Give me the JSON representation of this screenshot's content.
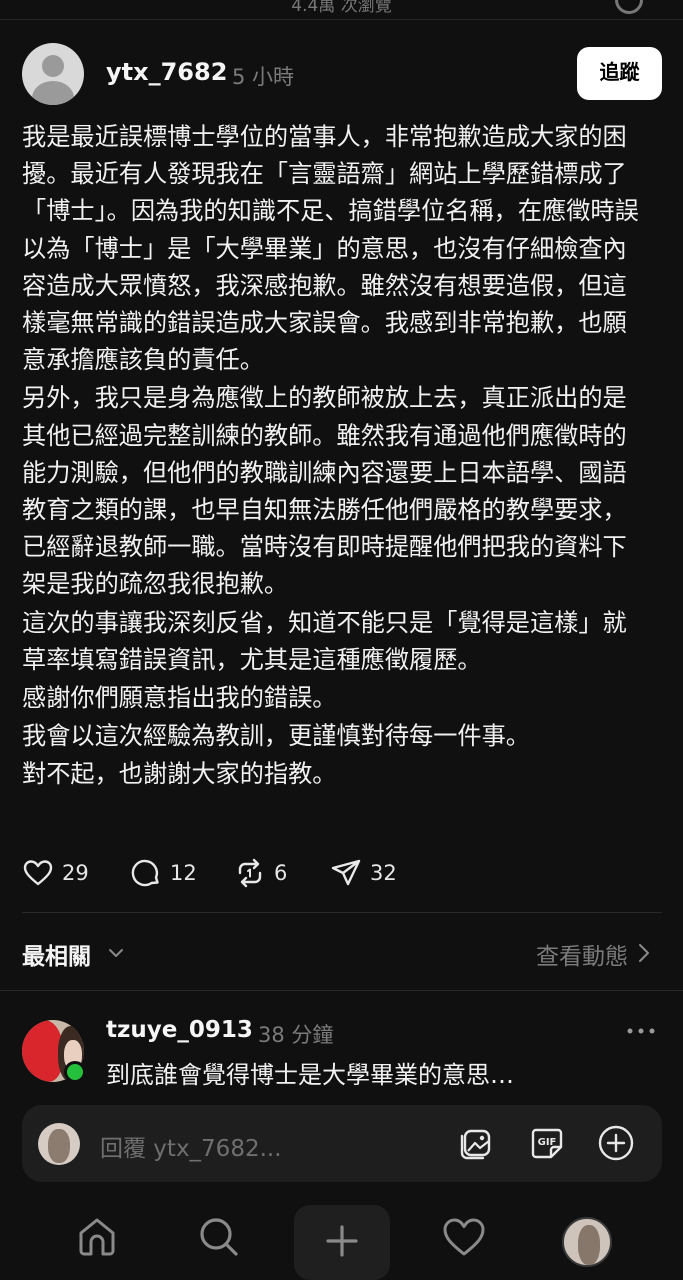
{
  "top": {
    "views_text": "4.4萬 次瀏覽"
  },
  "post": {
    "author": "ytx_7682",
    "time": "5 小時",
    "follow_label": "追蹤",
    "paragraphs": [
      "我是最近誤標博士學位的當事人，非常抱歉造成大家的困擾。最近有人發現我在「言靈語齋」網站上學歷錯標成了「博士」。因為我的知識不足、搞錯學位名稱，在應徵時誤以為「博士」是「大學畢業」的意思，也沒有仔細檢查內容造成大眾憤怒，我深感抱歉。雖然沒有想要造假，但這樣毫無常識的錯誤造成大家誤會。我感到非常抱歉，也願意承擔應該負的責任。",
      "另外，我只是身為應徵上的教師被放上去，真正派出的是其他已經過完整訓練的教師。雖然我有通過他們應徵時的能力測驗，但他們的教職訓練內容還要上日本語學、國語教育之類的課，也早自知無法勝任他們嚴格的教學要求，已經辭退教師一職。當時沒有即時提醒他們把我的資料下架是我的疏忽我很抱歉。",
      "這次的事讓我深刻反省，知道不能只是「覺得是這樣」就草率填寫錯誤資訊，尤其是這種應徵履歷。",
      "感謝你們願意指出我的錯誤。",
      "我會以這次經驗為教訓，更謹慎對待每一件事。",
      "對不起，也謝謝大家的指教。"
    ],
    "stats": {
      "likes": "29",
      "comments": "12",
      "reposts": "6",
      "shares": "32"
    }
  },
  "replies_header": {
    "sort_label": "最相關",
    "activity_label": "查看動態"
  },
  "reply": {
    "author": "tzuye_0913",
    "time": "38 分鐘",
    "text": "到底誰會覺得博士是大學畢業的意思…"
  },
  "composer": {
    "placeholder": "回覆 ytx_7682..."
  },
  "icons": {
    "like": "heart-icon",
    "comment": "comment-bubble-icon",
    "repost": "repost-icon",
    "share": "send-icon",
    "home": "home-icon",
    "search": "search-icon",
    "new": "plus-icon",
    "activity": "heart-icon"
  }
}
